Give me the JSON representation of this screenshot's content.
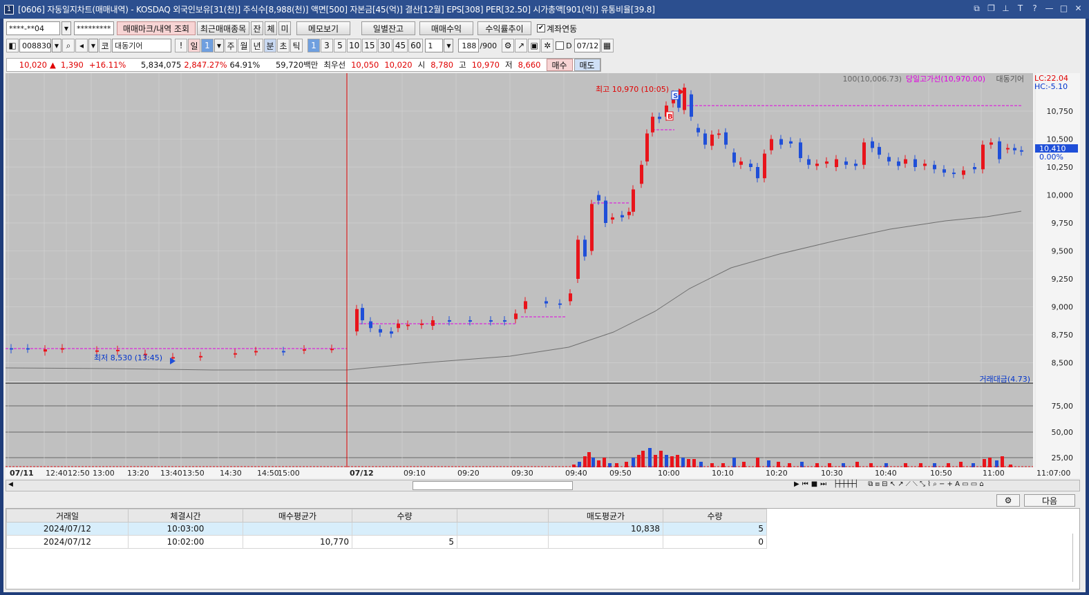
{
  "window": {
    "index": "1",
    "title": "[0606] 자동일지차트(매매내역) - KOSDAQ 외국인보유[31(천)] 주식수[8,988(천)] 액면[500] 자본금[45(억)] 결산[12월] EPS[308] PER[32.50] 시가총액[901(억)] 유통비율[39.8]"
  },
  "toolbar": {
    "account": "****-**04",
    "password": "*********",
    "btn_mark": "매매마크/내역 조회",
    "btn_recent": "최근매매종목",
    "t_jan": "잔",
    "t_che": "체",
    "t_mi": "미",
    "btn_memo": "메모보기",
    "btn_daily": "일별잔고",
    "btn_profit": "매매수익",
    "btn_rate": "수익률추이",
    "link_label": "계좌연동"
  },
  "toolbar2": {
    "code": "008830",
    "name": "대동기어",
    "period_day": "일",
    "period_day_n": "1",
    "week": "주",
    "month": "월",
    "year": "년",
    "minute": "분",
    "sec": "초",
    "tick": "틱",
    "intervals": [
      "1",
      "3",
      "5",
      "10",
      "15",
      "30",
      "45",
      "60"
    ],
    "interval_input": "1",
    "count": "188",
    "count_max": "/900",
    "d_label": "D",
    "date": "07/12"
  },
  "quote": {
    "price": "10,020",
    "arrow": "▲",
    "change": "1,390",
    "rate": "+16.11%",
    "volume": "5,834,075",
    "vol_rate": "2,847.27%",
    "turnover": "64.91%",
    "amount": "59,720백만",
    "best_label": "최우선",
    "ask": "10,050",
    "bid": "10,020",
    "open_label": "시",
    "open": "8,780",
    "high_label": "고",
    "high": "10,970",
    "low_label": "저",
    "low": "8,660",
    "buy_btn": "매수",
    "sell_btn": "매도"
  },
  "chart": {
    "legend_ma": "100(10,006.73)",
    "legend_high_line": "당일고가선(10,970.00)",
    "legend_name": "대동기어",
    "lc": "LC:22.04",
    "hc": "HC:-5.10",
    "high_note": "최고 10,970 (10:05)",
    "low_note": "최저 8,530 (13:45)",
    "price_label": "10,410",
    "pct_label": "0.00%",
    "volume_legend": "거래대금(4.73)",
    "price_ticks": [
      "10,750",
      "10,500",
      "10,250",
      "10,000",
      "9,750",
      "9,500",
      "9,250",
      "9,000",
      "8,750",
      "8,500"
    ],
    "vol_ticks": [
      "75,00",
      "50,00",
      "25,00"
    ],
    "time_labels": [
      "07/11",
      "12:40",
      "12:50",
      "13:00",
      "13:20",
      "13:40",
      "13:50",
      "14:30",
      "14:50",
      "15:00",
      "07/12",
      "09:10",
      "09:20",
      "09:30",
      "09:40",
      "09:50",
      "10:00",
      "10:10",
      "10:20",
      "10:30",
      "10:40",
      "10:50",
      "11:00",
      "11:07:00"
    ],
    "colors": {
      "up": "#e8141b",
      "down": "#1f4fd8",
      "ma": "#6e6e6e",
      "highline": "#e000e0",
      "bg": "#c0c0c0"
    }
  },
  "grid": {
    "headers": [
      "거래일",
      "체결시간",
      "매수평균가",
      "수량",
      "",
      "매도평균가",
      "수량"
    ],
    "rows": [
      [
        "2024/07/12",
        "10:03:00",
        "",
        "",
        "",
        "10,838",
        "5"
      ],
      [
        "2024/07/12",
        "10:02:00",
        "10,770",
        "5",
        "",
        "",
        "0"
      ]
    ],
    "next_btn": "다음"
  }
}
